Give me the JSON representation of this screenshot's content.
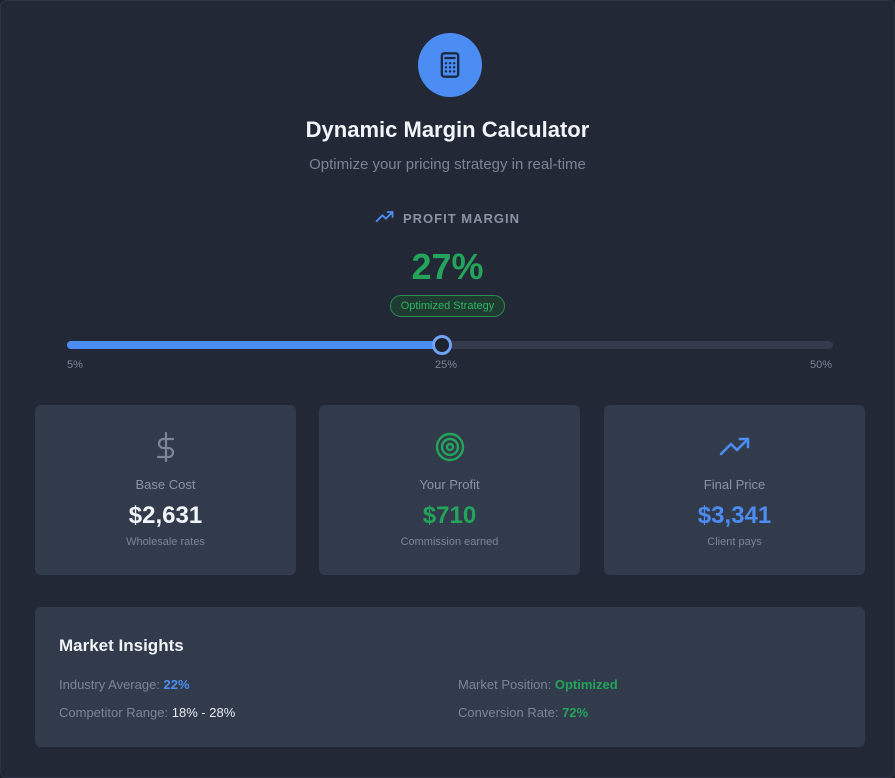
{
  "header": {
    "logo_icon": "calculator-icon",
    "title": "Dynamic Margin Calculator",
    "subtitle": "Optimize your pricing strategy in real-time"
  },
  "margin": {
    "label_icon": "trending-up-icon",
    "label": "PROFIT MARGIN",
    "value_text": "27%",
    "badge": "Optimized Strategy",
    "slider": {
      "min_label": "5%",
      "mid_label": "25%",
      "max_label": "50%",
      "fill_fraction": 0.49
    }
  },
  "cards": [
    {
      "icon": "dollar-icon",
      "label": "Base Cost",
      "value": "$2,631",
      "sub": "Wholesale rates"
    },
    {
      "icon": "target-icon",
      "label": "Your Profit",
      "value": "$710",
      "sub": "Commission earned"
    },
    {
      "icon": "trending-up-icon",
      "label": "Final Price",
      "value": "$3,341",
      "sub": "Client pays"
    }
  ],
  "insights": {
    "title": "Market Insights",
    "industry_average": {
      "label": "Industry Average: ",
      "value": "22%"
    },
    "competitor_range": {
      "label": "Competitor Range: ",
      "value": "18% - 28%"
    },
    "market_position": {
      "label": "Market Position: ",
      "value": "Optimized"
    },
    "conversion_rate": {
      "label": "Conversion Rate: ",
      "value": "72%"
    }
  },
  "colors": {
    "accent_blue": "#4b8df2",
    "success_green": "#22a45a",
    "background": "#222835",
    "card": "#323b4c"
  }
}
